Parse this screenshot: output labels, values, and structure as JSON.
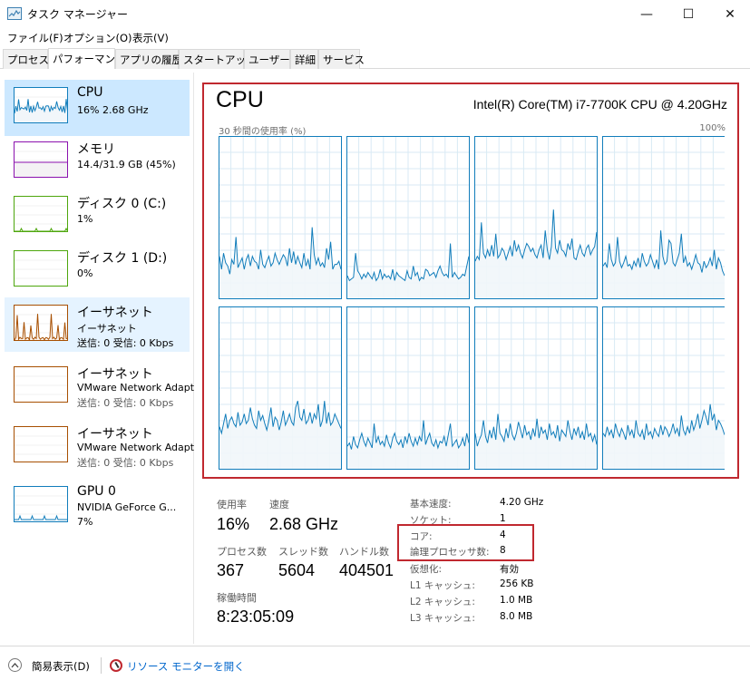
{
  "window": {
    "title": "タスク マネージャー",
    "minimize_glyph": "—",
    "maximize_glyph": "☐",
    "close_glyph": "✕"
  },
  "menu": [
    "ファイル(F)",
    "オプション(O)",
    "表示(V)"
  ],
  "tabs": [
    "プロセス",
    "パフォーマンス",
    "アプリの履歴",
    "スタートアップ",
    "ユーザー",
    "詳細",
    "サービス"
  ],
  "active_tab": "パフォーマンス",
  "sidebar": {
    "items": [
      {
        "title": "CPU",
        "line1": "16%  2.68 GHz",
        "line2": "",
        "color": "#117dbb",
        "fill": "#f1f6fa",
        "selected": true
      },
      {
        "title": "メモリ",
        "line1": "14.4/31.9 GB (45%)",
        "line2": "",
        "color": "#8b12ae",
        "fill": "#f4f2f4"
      },
      {
        "title": "ディスク 0 (C:)",
        "line1": "1%",
        "line2": "",
        "color": "#4da60c",
        "fill": "#effde6"
      },
      {
        "title": "ディスク 1 (D:)",
        "line1": "0%",
        "line2": "",
        "color": "#4da60c",
        "fill": "#effde6"
      },
      {
        "title": "イーサネット",
        "line1": "イーサネット",
        "line2": "送信: 0  受信: 0 Kbps",
        "color": "#a74f01",
        "fill": "#fcf3eb",
        "hover": true
      },
      {
        "title": "イーサネット",
        "line1": "VMware Network Adapt",
        "line2": "送信: 0  受信: 0 Kbps",
        "color": "#a74f01",
        "fill": "#fcf3eb"
      },
      {
        "title": "イーサネット",
        "line1": "VMware Network Adapt",
        "line2": "送信: 0  受信: 0 Kbps",
        "color": "#a74f01",
        "fill": "#fcf3eb"
      },
      {
        "title": "GPU 0",
        "line1": "NVIDIA GeForce G...",
        "line2": "7%",
        "color": "#117dbb",
        "fill": "#f1f6fa"
      }
    ]
  },
  "main": {
    "title": "CPU",
    "model": "Intel(R) Core(TM) i7-7700K CPU @ 4.20GHz",
    "chart_caption_left": "30 秒間の使用率 (%)",
    "chart_caption_right": "100%",
    "stats": {
      "usage_label": "使用率",
      "usage_value": "16%",
      "speed_label": "速度",
      "speed_value": "2.68 GHz",
      "processes_label": "プロセス数",
      "processes_value": "367",
      "threads_label": "スレッド数",
      "threads_value": "5604",
      "handles_label": "ハンドル数",
      "handles_value": "404501",
      "uptime_label": "稼働時間",
      "uptime_value": "8:23:05:09"
    },
    "details": [
      {
        "label": "基本速度:",
        "value": "4.20 GHz"
      },
      {
        "label": "ソケット:",
        "value": "1"
      },
      {
        "label": "コア:",
        "value": "4"
      },
      {
        "label": "論理プロセッサ数:",
        "value": "8"
      },
      {
        "label": "仮想化:",
        "value": "有効"
      },
      {
        "label": "L1 キャッシュ:",
        "value": "256 KB"
      },
      {
        "label": "L2 キャッシュ:",
        "value": "1.0 MB"
      },
      {
        "label": "L3 キャッシュ:",
        "value": "8.0 MB"
      }
    ]
  },
  "footer": {
    "simple_view": "簡易表示(D)",
    "resource_monitor": "リソース モニターを開く"
  },
  "colors": {
    "cpu_line": "#117dbb",
    "cpu_grid": "#d9eaf4",
    "cpu_fill": "#f1f6fa",
    "highlight_red": "#c0282f",
    "selected_bg": "#cce8ff"
  },
  "chart_data": {
    "type": "line",
    "title": "30 秒間の使用率 (%)",
    "ylim": [
      0,
      100
    ],
    "grid": true,
    "series": [
      {
        "values": [
          26,
          18,
          28,
          22,
          20,
          15,
          24,
          21,
          38,
          19,
          22,
          25,
          18,
          24,
          27,
          20,
          26,
          23,
          22,
          18,
          30,
          21,
          19,
          23,
          26,
          20,
          22,
          28,
          24,
          21,
          24,
          27,
          25,
          20,
          31,
          22,
          29,
          21,
          26,
          22,
          19,
          28,
          20,
          24,
          18,
          44,
          27,
          21,
          25,
          20,
          22,
          19,
          31,
          24,
          35,
          18,
          21,
          21,
          23,
          18
        ]
      },
      {
        "values": [
          14,
          11,
          12,
          13,
          28,
          17,
          15,
          12,
          15,
          13,
          16,
          14,
          12,
          16,
          11,
          13,
          18,
          12,
          15,
          13,
          14,
          12,
          18,
          11,
          16,
          14,
          13,
          12,
          11,
          17,
          13,
          12,
          20,
          14,
          16,
          11,
          13,
          12,
          18,
          17,
          14,
          15,
          16,
          13,
          17,
          20,
          16,
          14,
          15,
          13,
          34,
          13,
          16,
          14,
          12,
          13,
          15,
          14,
          20,
          26
        ]
      },
      {
        "values": [
          23,
          26,
          24,
          47,
          28,
          25,
          30,
          26,
          33,
          26,
          40,
          25,
          27,
          31,
          29,
          24,
          28,
          32,
          26,
          36,
          29,
          33,
          28,
          25,
          30,
          34,
          32,
          29,
          31,
          27,
          25,
          30,
          33,
          25,
          42,
          30,
          24,
          32,
          55,
          31,
          28,
          36,
          30,
          29,
          26,
          34,
          30,
          37,
          25,
          24,
          29,
          33,
          28,
          26,
          31,
          33,
          27,
          30,
          32,
          41
        ]
      },
      {
        "values": [
          20,
          22,
          19,
          34,
          24,
          20,
          22,
          38,
          23,
          19,
          22,
          26,
          20,
          21,
          18,
          23,
          20,
          25,
          19,
          28,
          23,
          20,
          22,
          27,
          23,
          19,
          24,
          18,
          42,
          26,
          21,
          23,
          36,
          34,
          22,
          20,
          24,
          28,
          40,
          22,
          26,
          20,
          22,
          18,
          22,
          27,
          22,
          21,
          16,
          23,
          19,
          21,
          25,
          20,
          30,
          18,
          25,
          22,
          17,
          14
        ]
      },
      {
        "values": [
          26,
          22,
          28,
          34,
          25,
          30,
          32,
          28,
          26,
          35,
          27,
          29,
          34,
          28,
          30,
          38,
          31,
          27,
          25,
          36,
          30,
          33,
          28,
          24,
          30,
          38,
          26,
          32,
          30,
          24,
          29,
          36,
          27,
          30,
          34,
          29,
          27,
          38,
          42,
          32,
          30,
          37,
          28,
          30,
          35,
          28,
          34,
          31,
          40,
          26,
          30,
          42,
          28,
          35,
          27,
          29,
          34,
          31,
          28,
          25
        ]
      },
      {
        "values": [
          14,
          16,
          12,
          20,
          15,
          13,
          18,
          22,
          17,
          14,
          19,
          16,
          13,
          28,
          16,
          20,
          15,
          17,
          14,
          21,
          16,
          13,
          19,
          22,
          17,
          15,
          18,
          13,
          20,
          16,
          22,
          17,
          14,
          19,
          15,
          20,
          17,
          30,
          15,
          19,
          22,
          16,
          14,
          18,
          13,
          17,
          16,
          20,
          14,
          21,
          28,
          14,
          16,
          18,
          13,
          15,
          19,
          14,
          22,
          16
        ]
      },
      {
        "values": [
          22,
          14,
          18,
          21,
          30,
          20,
          16,
          24,
          19,
          26,
          18,
          34,
          22,
          20,
          17,
          25,
          19,
          28,
          21,
          18,
          22,
          29,
          24,
          19,
          27,
          21,
          23,
          18,
          25,
          20,
          31,
          19,
          26,
          22,
          24,
          18,
          28,
          21,
          23,
          19,
          27,
          17,
          24,
          22,
          20,
          30,
          23,
          18,
          25,
          21,
          26,
          19,
          23,
          18,
          28,
          20,
          22,
          17,
          21,
          15
        ]
      },
      {
        "values": [
          22,
          20,
          26,
          21,
          24,
          19,
          28,
          23,
          20,
          25,
          22,
          18,
          27,
          21,
          24,
          19,
          30,
          22,
          20,
          24,
          18,
          28,
          21,
          23,
          19,
          25,
          22,
          20,
          27,
          21,
          26,
          24,
          20,
          23,
          28,
          22,
          25,
          20,
          33,
          24,
          21,
          26,
          22,
          30,
          24,
          28,
          34,
          25,
          30,
          36,
          32,
          27,
          40,
          30,
          34,
          24,
          30,
          28,
          25,
          21
        ]
      }
    ]
  }
}
